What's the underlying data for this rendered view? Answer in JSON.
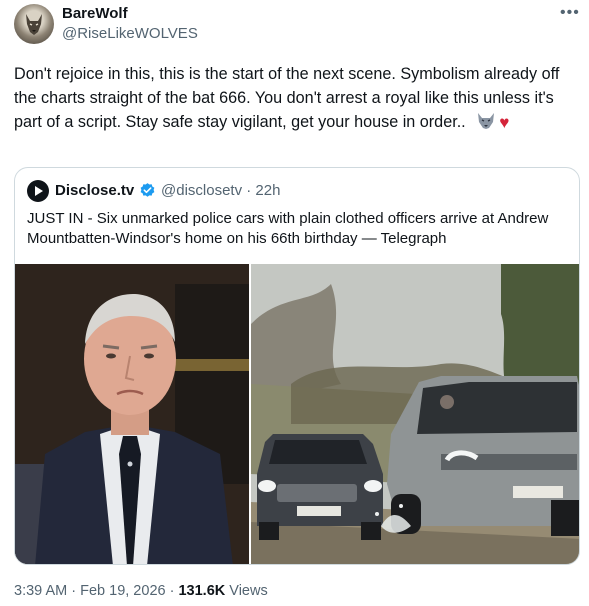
{
  "author": {
    "name": "BareWolf",
    "handle": "@RiseLikeWOLVES"
  },
  "post": {
    "text": "Don't rejoice in this, this is the start of the next scene. Symbolism already off the charts straight of the bat 666. You don't arrest a royal like this unless it's part of a script. Stay safe stay vigilant, get your house in order..",
    "heart": "♥",
    "time": "3:39 AM",
    "date": "Feb 19, 2026",
    "views_count": "131.6K",
    "views_label": "Views",
    "sep": "·"
  },
  "quote": {
    "name": "Disclose.tv",
    "handle": "@disclosetv",
    "age": "· 22h",
    "text": "JUST IN - Six unmarked police cars with plain clothed officers arrive at Andrew Mountbatten-Windsor's home on his 66th birthday — Telegraph"
  },
  "icons": {
    "more": "more-icon",
    "verified": "verified-badge-icon",
    "logo": "disclose-logo-icon"
  },
  "colors": {
    "text": "#0f1419",
    "muted": "#536471",
    "verified": "#1d9bf0",
    "heart": "#d4243a",
    "border": "#cfd9de"
  }
}
